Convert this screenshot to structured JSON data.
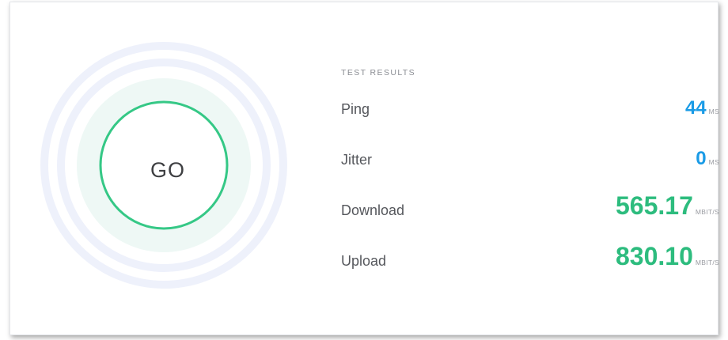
{
  "go_button": {
    "label": "GO"
  },
  "results": {
    "title": "TEST RESULTS",
    "rows": [
      {
        "label": "Ping",
        "value": "44",
        "unit": "MS",
        "color": "#1a9be6"
      },
      {
        "label": "Jitter",
        "value": "0",
        "unit": "MS",
        "color": "#1a9be6"
      },
      {
        "label": "Download",
        "value": "565.17",
        "unit": "MBIT/S",
        "color": "#2dbc7e"
      },
      {
        "label": "Upload",
        "value": "830.10",
        "unit": "MBIT/S",
        "color": "#2dbc7e"
      }
    ]
  },
  "colors": {
    "ring_accent": "#35c886",
    "ring_halo": "#eef2fb",
    "inner_fill": "#eef8f5"
  }
}
